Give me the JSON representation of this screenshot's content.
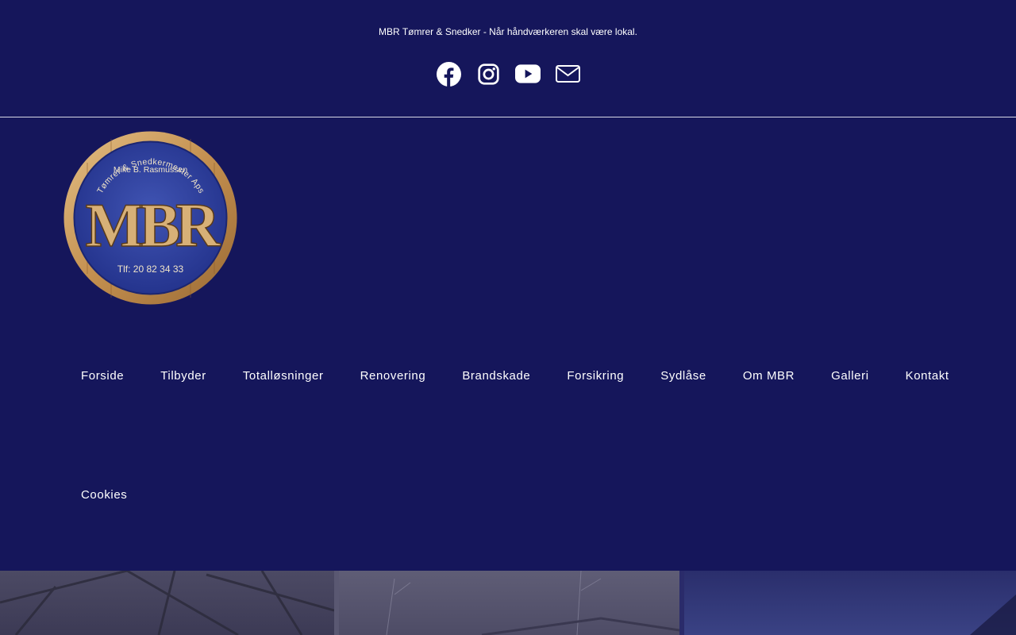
{
  "header": {
    "tagline": "MBR Tømrer & Snedker - Når håndværkeren skal være lokal."
  },
  "social": [
    {
      "icon": "facebook-icon"
    },
    {
      "icon": "instagram-icon"
    },
    {
      "icon": "youtube-icon"
    },
    {
      "icon": "email-icon"
    }
  ],
  "logo": {
    "arc_text": "Tømrer & Snedkermester Aps",
    "owner": "Mike B. Rasmussen",
    "monogram": "MBR",
    "phone": "Tlf: 20 82 34 33"
  },
  "nav": {
    "items": [
      "Forside",
      "Tilbyder",
      "Totalløsninger",
      "Renovering",
      "Brandskade",
      "Forsikring",
      "Sydlåse",
      "Om MBR",
      "Galleri",
      "Kontakt",
      "Cookies"
    ]
  },
  "colors": {
    "background": "#15165b",
    "text": "#ffffff",
    "logo_blue": "#2e3f9e",
    "logo_wood": "#c99a5b"
  }
}
